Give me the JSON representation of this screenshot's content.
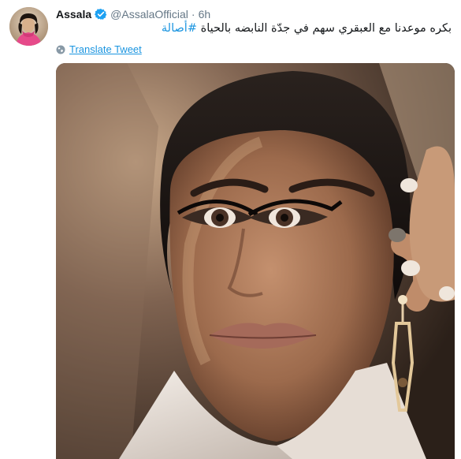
{
  "tweet": {
    "display_name": "Assala",
    "handle": "@AssalaOfficial",
    "separator": "·",
    "time": "6h",
    "text": "بكره موعدنا مع العبقري سهم في جدّة النابضه بالحياة",
    "hashtag": "#أصالة",
    "translate_label": "Translate Tweet"
  },
  "icons": {
    "verified": "verified-badge-icon",
    "translate": "globe-icon"
  },
  "colors": {
    "link": "#1b95e0",
    "verified": "#1da1f2",
    "secondary_text": "#657786",
    "primary_text": "#14171a"
  }
}
